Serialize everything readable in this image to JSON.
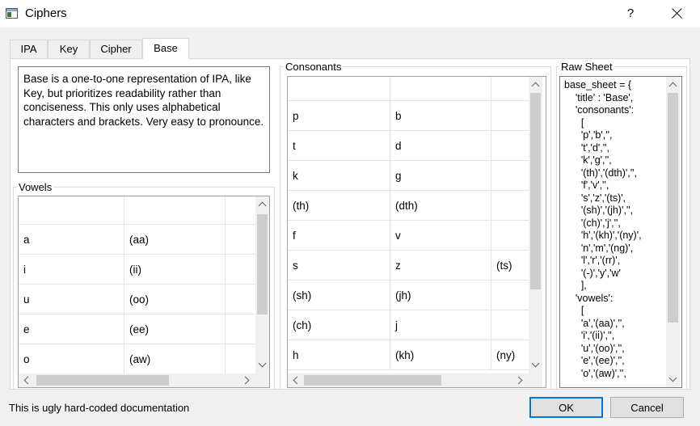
{
  "window": {
    "title": "Ciphers",
    "help": "?"
  },
  "tabs": [
    {
      "label": "IPA"
    },
    {
      "label": "Key"
    },
    {
      "label": "Cipher"
    },
    {
      "label": "Base"
    }
  ],
  "description": "Base is a one-to-one representation of IPA, like Key, but prioritizes readability rather than conciseness. This only uses alphabetical characters and brackets. Very easy to pronounce.",
  "vowels": {
    "label": "Vowels",
    "rows": [
      [
        "a",
        "(aa)"
      ],
      [
        "i",
        "(ii)"
      ],
      [
        "u",
        "(oo)"
      ],
      [
        "e",
        "(ee)"
      ],
      [
        "o",
        "(aw)"
      ]
    ]
  },
  "consonants": {
    "label": "Consonants",
    "rows": [
      [
        "p",
        "b",
        ""
      ],
      [
        "t",
        "d",
        ""
      ],
      [
        "k",
        "g",
        ""
      ],
      [
        "(th)",
        "(dth)",
        ""
      ],
      [
        "f",
        "v",
        ""
      ],
      [
        "s",
        "z",
        "(ts)"
      ],
      [
        "(sh)",
        "(jh)",
        ""
      ],
      [
        "(ch)",
        "j",
        ""
      ],
      [
        "h",
        "(kh)",
        "(ny)"
      ]
    ]
  },
  "raw_sheet": {
    "label": "Raw Sheet",
    "text": "base_sheet = {\n    'title' : 'Base',\n    'consonants':\n      [\n      'p','b','',\n      't','d','',\n      'k','g','',\n      '(th)','(dth)','',\n      'f','v','',\n      's','z','(ts)',\n      '(sh)','(jh)','',\n      '(ch)','j','',\n      'h','(kh)','(ny)',\n      'n','m','(ng)',\n      'l','r','(rr)',\n      '(-)','y','w'\n      ],\n    'vowels':\n      [\n      'a','(aa)','',\n      'i','(ii)','',\n      'u','(oo)','',\n      'e','(ee)','',\n      'o','(aw)','',"
  },
  "status": "This is ugly hard-coded documentation",
  "buttons": {
    "ok": "OK",
    "cancel": "Cancel"
  }
}
